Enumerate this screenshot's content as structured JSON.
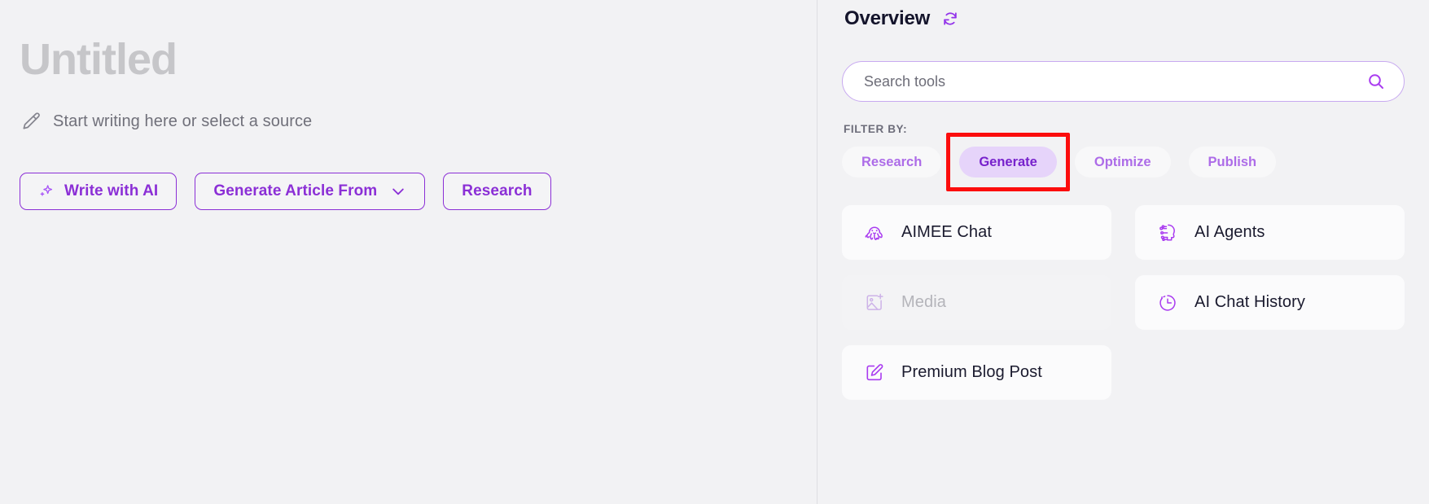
{
  "editor": {
    "title": "Untitled",
    "placeholder": "Start writing here or select a source",
    "pencil_icon": "pencil-icon",
    "actions": [
      {
        "label": "Write with AI",
        "icon": "sparkle-icon",
        "has_chevron": false
      },
      {
        "label": "Generate Article From",
        "icon": null,
        "has_chevron": true
      },
      {
        "label": "Research",
        "icon": null,
        "has_chevron": false
      }
    ]
  },
  "tools_panel": {
    "title": "Overview",
    "refresh_icon": "refresh-icon",
    "search": {
      "placeholder": "Search tools",
      "value": "",
      "icon": "search-icon"
    },
    "filter": {
      "label": "FILTER BY:",
      "chips": [
        {
          "label": "Research",
          "active": false,
          "highlighted": false
        },
        {
          "label": "Generate",
          "active": true,
          "highlighted": true
        },
        {
          "label": "Optimize",
          "active": false,
          "highlighted": false
        },
        {
          "label": "Publish",
          "active": false,
          "highlighted": false
        }
      ]
    },
    "tools": [
      {
        "label": "AIMEE Chat",
        "icon": "octopus-icon",
        "disabled": false
      },
      {
        "label": "AI Agents",
        "icon": "ai-head-circuit-icon",
        "disabled": false
      },
      {
        "label": "Media",
        "icon": "image-plus-icon",
        "disabled": true
      },
      {
        "label": "AI Chat History",
        "icon": "clock-history-icon",
        "disabled": false
      },
      {
        "label": "Premium Blog Post",
        "icon": "square-pencil-icon",
        "disabled": false
      }
    ]
  },
  "colors": {
    "accent": "#8b2fd6",
    "accent_light": "#ad6ce8",
    "chip_active_bg": "#e6d4fa",
    "chip_active_text": "#7722cc",
    "highlight_box": "#fc0d0d",
    "page_bg": "#f2f2f4",
    "card_bg": "#fbfbfc",
    "title_grey": "#c6c6c9"
  }
}
